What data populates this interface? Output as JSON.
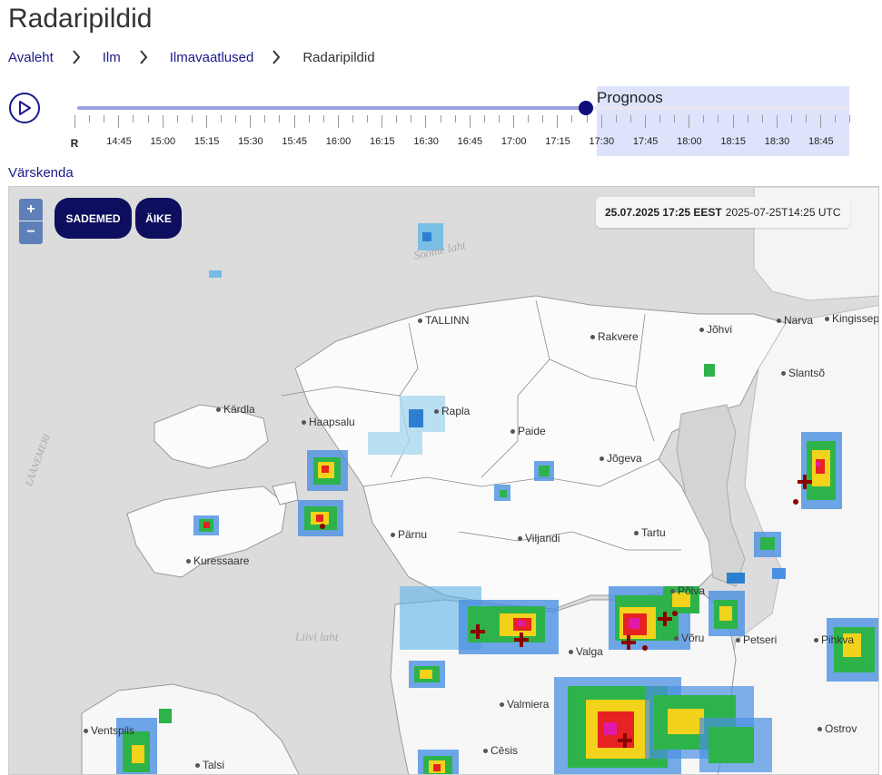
{
  "page": {
    "title": "Radaripildid"
  },
  "breadcrumb": {
    "items": [
      {
        "label": "Avaleht"
      },
      {
        "label": "Ilm"
      },
      {
        "label": "Ilmavaatlused"
      },
      {
        "label": "Radaripildid"
      }
    ]
  },
  "timeline": {
    "forecast_label": "Prognoos",
    "realtime_label": "R",
    "times": [
      "14:45",
      "15:00",
      "15:15",
      "15:30",
      "15:45",
      "16:00",
      "16:15",
      "16:30",
      "16:45",
      "17:00",
      "17:15",
      "17:30",
      "17:45",
      "18:00",
      "18:15",
      "18:30",
      "18:45"
    ],
    "current_time": "17:25"
  },
  "refresh": {
    "label": "Värskenda"
  },
  "map": {
    "zoom_in": "+",
    "zoom_out": "−",
    "layers": [
      {
        "label": "SADEMED"
      },
      {
        "label": "ÄIKE"
      }
    ],
    "timestamp_local": "25.07.2025 17:25 EEST",
    "timestamp_utc": "2025-07-25T14:25 UTC",
    "cities": [
      "TALLINN",
      "Rakvere",
      "Jõhvi",
      "Narva",
      "Kingissep",
      "Slantsõ",
      "Kärdla",
      "Haapsalu",
      "Rapla",
      "Paide",
      "Jõgeva",
      "Kuressaare",
      "Pärnu",
      "Viljandi",
      "Tartu",
      "Põlva",
      "Võru",
      "Petseri",
      "Pihkva",
      "Valga",
      "Valmiera",
      "Ventspils",
      "Talsi",
      "Cēsis",
      "Ostrov"
    ],
    "seas": [
      "Soome laht",
      "LÄÄNEMERI",
      "Liivi laht"
    ]
  },
  "colors": {
    "accent": "#1a1a8c",
    "button_bg": "#0e0e5e",
    "forecast_bg": "#dde3fb"
  }
}
